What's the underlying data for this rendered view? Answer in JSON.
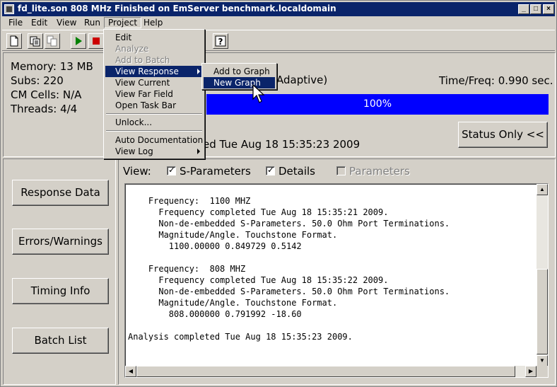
{
  "window": {
    "title": "fd_lite.son  808 MHz Finished on EmServer benchmark.localdomain",
    "minimize": "_",
    "maximize": "□",
    "close": "×"
  },
  "menubar": {
    "items": [
      {
        "label": "File"
      },
      {
        "label": "Edit"
      },
      {
        "label": "View"
      },
      {
        "label": "Run"
      },
      {
        "label": "Project"
      },
      {
        "label": "Help"
      }
    ]
  },
  "toolbar": {
    "buttons": [
      "new-file-icon",
      "open-project-icon",
      "copy-icon",
      "run-icon",
      "stop-icon",
      "help-icon"
    ],
    "run_color": "#008000",
    "stop_color": "#cc0000"
  },
  "project_menu": {
    "items": [
      {
        "label": "Edit",
        "enabled": true
      },
      {
        "label": "Analyze",
        "enabled": false
      },
      {
        "label": "Add to Batch",
        "enabled": false
      },
      {
        "label": "View Response",
        "enabled": true,
        "highlighted": true,
        "submenu": true
      },
      {
        "label": "View Current",
        "enabled": true
      },
      {
        "label": "View Far Field",
        "enabled": true
      },
      {
        "label": "Open Task Bar",
        "enabled": true
      },
      {
        "label": "Unlock...",
        "enabled": true
      },
      {
        "label": "Auto Documentation",
        "enabled": true
      },
      {
        "label": "View Log",
        "enabled": true,
        "submenu": true
      }
    ]
  },
  "view_response_submenu": {
    "items": [
      {
        "label": "Add to Graph",
        "highlighted": false
      },
      {
        "label": "New Graph",
        "highlighted": true
      }
    ]
  },
  "status": {
    "memory": "Memory: 13 MB",
    "subs": "Subs: 220",
    "cm_cells": "CM Cells: N/A",
    "threads": "Threads: 4/4",
    "mode_fragment": "Adaptive)",
    "time_freq": "Time/Freq:  0.990 sec.",
    "progress_label": "100%",
    "progress_fraction": 1.0,
    "progress_color": "#0000ff",
    "finished_fragment": "ed Tue Aug 18 15:35:23 2009",
    "status_only_button": "Status Only <<"
  },
  "left_buttons": {
    "response_data": "Response Data",
    "errors_warnings": "Errors/Warnings",
    "timing_info": "Timing Info",
    "batch_list": "Batch List"
  },
  "view_options": {
    "view_label": "View:",
    "s_parameters": {
      "label": "S-Parameters",
      "checked": true
    },
    "details": {
      "label": "Details",
      "checked": true
    },
    "parameters": {
      "label": "Parameters",
      "checked": false,
      "enabled": false
    }
  },
  "log_lines": [
    "    Frequency:  1100 MHZ",
    "      Frequency completed Tue Aug 18 15:35:21 2009.",
    "      Non-de-embedded S-Parameters. 50.0 Ohm Port Terminations.",
    "      Magnitude/Angle. Touchstone Format.",
    "        1100.00000 0.849729 0.5142",
    "",
    "    Frequency:  808 MHZ",
    "      Frequency completed Tue Aug 18 15:35:22 2009.",
    "      Non-de-embedded S-Parameters. 50.0 Ohm Port Terminations.",
    "      Magnitude/Angle. Touchstone Format.",
    "        808.000000 0.791992 -18.60",
    "",
    "Analysis completed Tue Aug 18 15:35:23 2009."
  ],
  "colors": {
    "titlebar": "#0a246a",
    "highlight": "#0a246a",
    "face": "#d4d0c8"
  }
}
